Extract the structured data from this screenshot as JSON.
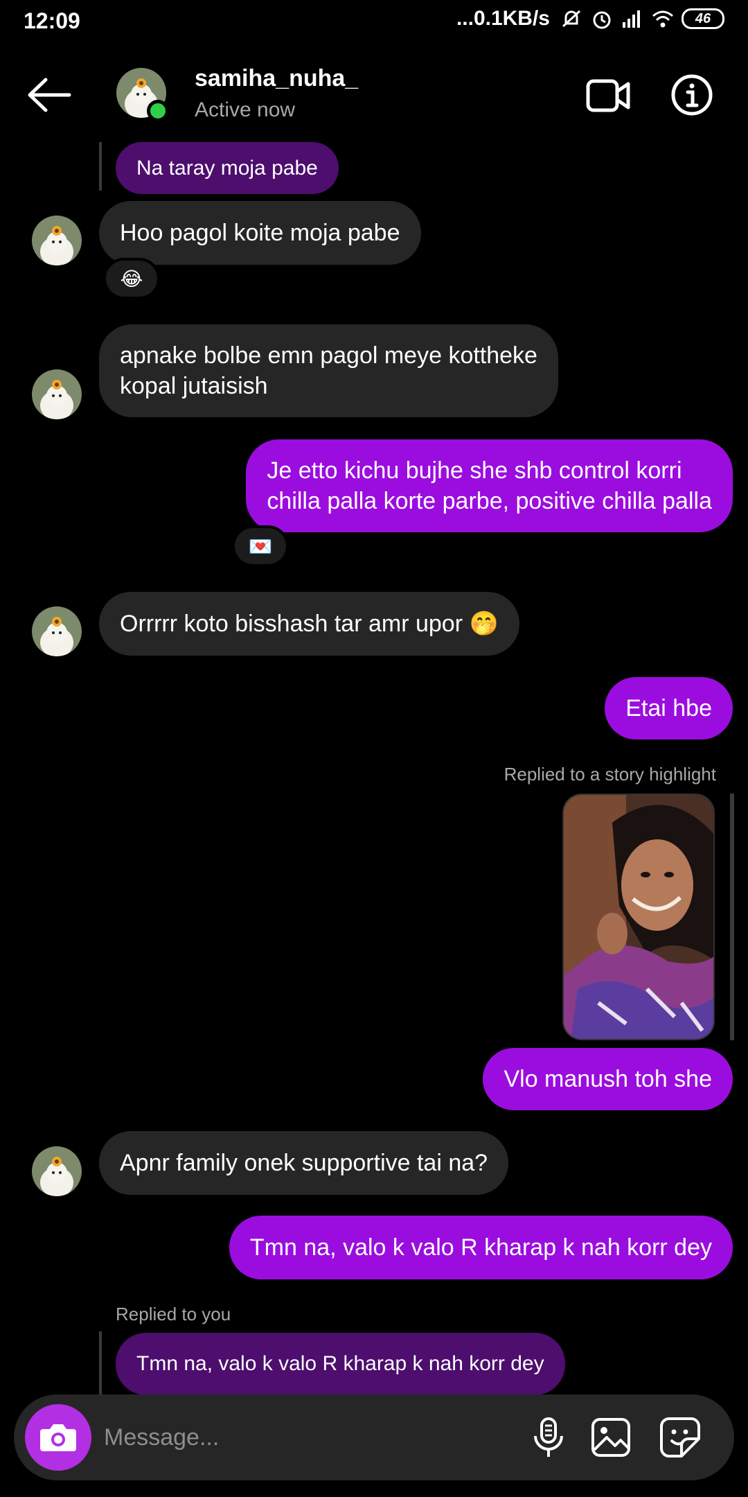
{
  "status_bar": {
    "time": "12:09",
    "network_speed": "...0.1KB/s",
    "battery": "46"
  },
  "header": {
    "username": "samiha_nuha_",
    "status": "Active now"
  },
  "messages": {
    "quoted_top": "Na taray moja pabe",
    "m1": "Hoo pagol koite moja pabe",
    "m1_reaction": "😂",
    "m2_line1": "apnake bolbe emn pagol meye kottheke",
    "m2_line2": "kopal jutaisish",
    "m3_line1": "Je etto kichu bujhe she shb control korri",
    "m3_line2": "chilla palla korte parbe, positive chilla palla",
    "m3_reaction": "💌",
    "m4": "Orrrrr koto bisshash tar amr upor 🤭",
    "m5": "Etai hbe",
    "story_label": "Replied to a story highlight",
    "m6": "Vlo manush toh she",
    "m7": "Apnr family onek supportive tai na?",
    "m8": "Tmn na, valo k valo R kharap k nah korr dey",
    "reply_label": "Replied to you",
    "quoted_bottom": "Tmn na, valo k valo R kharap k nah korr dey"
  },
  "composer": {
    "placeholder": "Message..."
  }
}
